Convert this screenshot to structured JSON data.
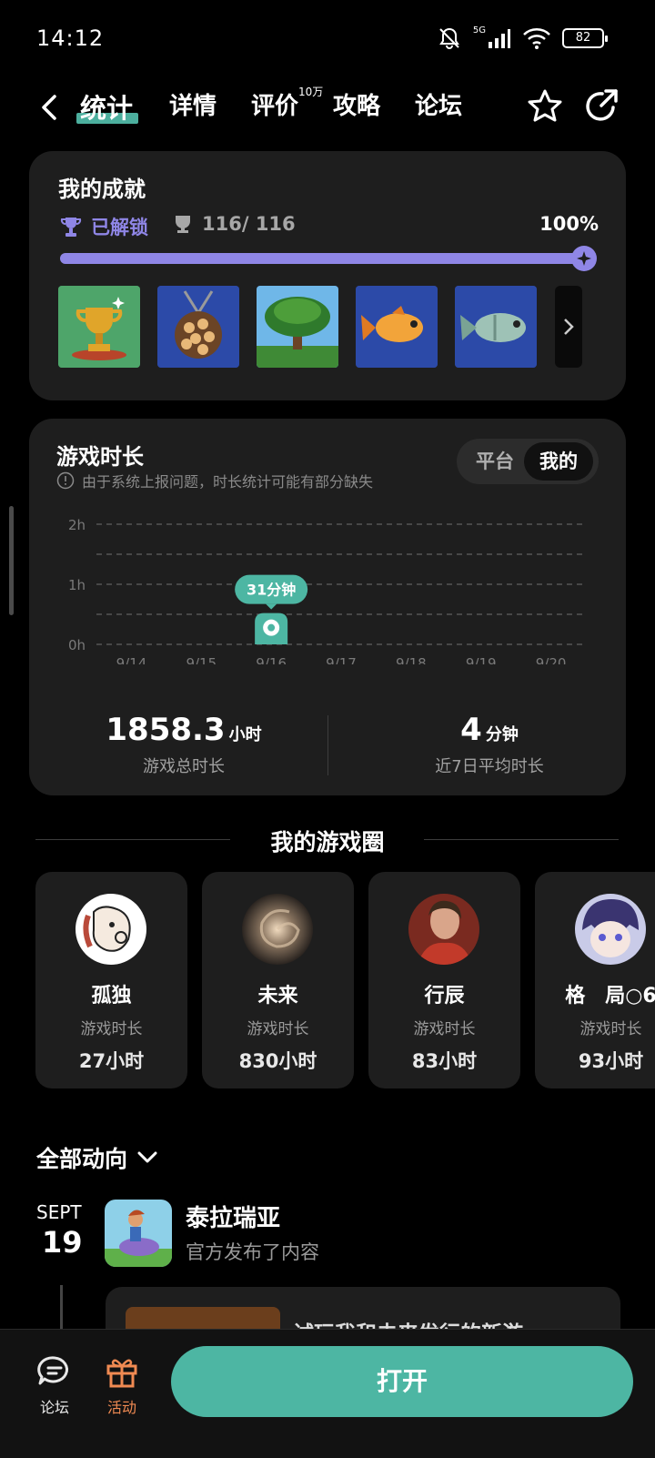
{
  "status_bar": {
    "time": "14:12",
    "network": "5G",
    "battery": "82"
  },
  "nav": {
    "tabs": [
      {
        "label": "统计",
        "active": true
      },
      {
        "label": "详情",
        "active": false
      },
      {
        "label": "评价",
        "active": false,
        "badge": "10万"
      },
      {
        "label": "攻略",
        "active": false
      },
      {
        "label": "论坛",
        "active": false
      }
    ],
    "icons": [
      "back-icon",
      "star-icon",
      "share-icon"
    ]
  },
  "achievements": {
    "title": "我的成就",
    "unlocked_label": "已解锁",
    "count": "116/ 116",
    "percent_text": "100%",
    "progress": 1.0,
    "accent": "#8f86e6",
    "thumbs": [
      "trophy-achievement",
      "coin-bag-achievement",
      "tree-achievement",
      "goldfish-achievement",
      "fish-achievement"
    ]
  },
  "play_time": {
    "title": "游戏时长",
    "notice": "由于系统上报问题，时长统计可能有部分缺失",
    "toggle": {
      "platform": "平台",
      "mine": "我的"
    },
    "total_value": "1858.3",
    "total_unit": "小时",
    "total_label": "游戏总时长",
    "avg_value": "4",
    "avg_unit": "分钟",
    "avg_label": "近7日平均时长"
  },
  "chart_data": {
    "type": "bar",
    "categories": [
      "9/14",
      "9/15",
      "9/16",
      "9/17",
      "9/18",
      "9/19",
      "9/20"
    ],
    "values": [
      0,
      0,
      0.52,
      0,
      0,
      0,
      0
    ],
    "y_ticks": [
      "0h",
      "1h",
      "2h"
    ],
    "ylim": [
      0,
      2
    ],
    "tooltip": "31分钟",
    "color": "#4db6a3",
    "grid": true
  },
  "circle": {
    "title": "我的游戏圈",
    "friends": [
      {
        "name": "孤独",
        "label": "游戏时长",
        "hours": "27小时"
      },
      {
        "name": "未来",
        "label": "游戏时长",
        "hours": "830小时"
      },
      {
        "name": "行辰",
        "label": "游戏时长",
        "hours": "83小时"
      },
      {
        "name": "格　局○6",
        "label": "游戏时长",
        "hours": "93小时"
      }
    ]
  },
  "feed": {
    "filter_label": "全部动向",
    "month": "SEPT",
    "day": "19",
    "game_name": "泰拉瑞亚",
    "game_sub": "官方发布了内容",
    "post_title": "试玩我和未来发行的新游"
  },
  "bottom_bar": {
    "forum_label": "论坛",
    "activity_label": "活动",
    "open_label": "打开",
    "accent": "#4db6a3",
    "activity_color": "#f08a52"
  }
}
